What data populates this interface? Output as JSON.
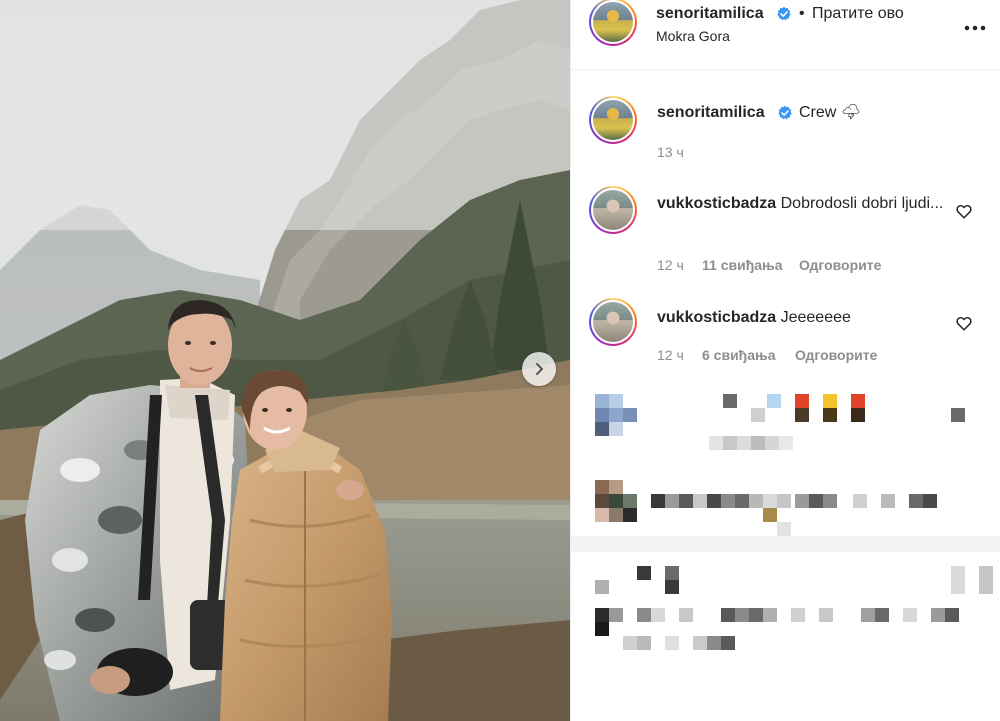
{
  "post": {
    "username": "senoritamilica",
    "separator": "•",
    "follow_label": "Пратите ово",
    "location": "Mokra Gora"
  },
  "caption": {
    "username": "senoritamilica",
    "text": "Crew 🌩",
    "time": "13 ч"
  },
  "comments": [
    {
      "username": "vukkosticbadza",
      "text": "Dobrodosli dobri ljudi...",
      "time": "12 ч",
      "likes": "11 свиђања",
      "reply": "Одговорите"
    },
    {
      "username": "vukkosticbadza",
      "text": "Jeeeeeee",
      "time": "12 ч",
      "likes": "6 свиђања",
      "reply": "Одговорите"
    }
  ],
  "icons": {
    "verified": "verified-badge-icon",
    "more": "more-options-icon",
    "heart": "heart-icon",
    "next": "chevron-right-icon"
  },
  "colors": {
    "verified": "#3897f0",
    "muted": "#8e8e8e",
    "text": "#262626"
  }
}
